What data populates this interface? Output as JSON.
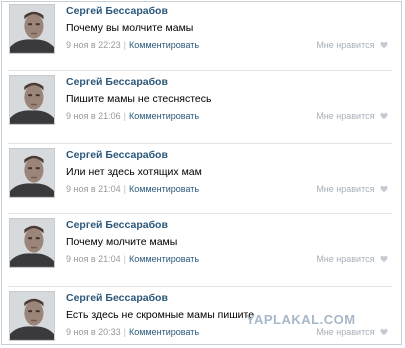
{
  "comments": [
    {
      "author": "Сергей Бессарабов",
      "text": "Почему вы молчите мамы",
      "date": "9 ноя в 22:23",
      "reply": "Комментировать",
      "like": "Мне нравится"
    },
    {
      "author": "Сергей Бессарабов",
      "text": "Пишите мамы не стеснястесь",
      "date": "9 ноя в 21:06",
      "reply": "Комментировать",
      "like": "Мне нравится"
    },
    {
      "author": "Сергей Бессарабов",
      "text": "Или нет здесь хотящих мам",
      "date": "9 ноя в 21:04",
      "reply": "Комментировать",
      "like": "Мне нравится"
    },
    {
      "author": "Сергей Бессарабов",
      "text": "Почему молчите мамы",
      "date": "9 ноя в 21:04",
      "reply": "Комментировать",
      "like": "Мне нравится"
    },
    {
      "author": "Сергей Бессарабов",
      "text": "Есть здесь не скромные мамы пишите",
      "date": "9 ноя в 20:33",
      "reply": "Комментировать",
      "like": "Мне нравится"
    }
  ],
  "watermark": "YAPLAKAL.COM",
  "colors": {
    "link": "#2b587a",
    "meta": "#999999",
    "like": "#a7b0bb",
    "divider": "#dfe3e8"
  },
  "icons": {
    "like": "heart-icon"
  }
}
